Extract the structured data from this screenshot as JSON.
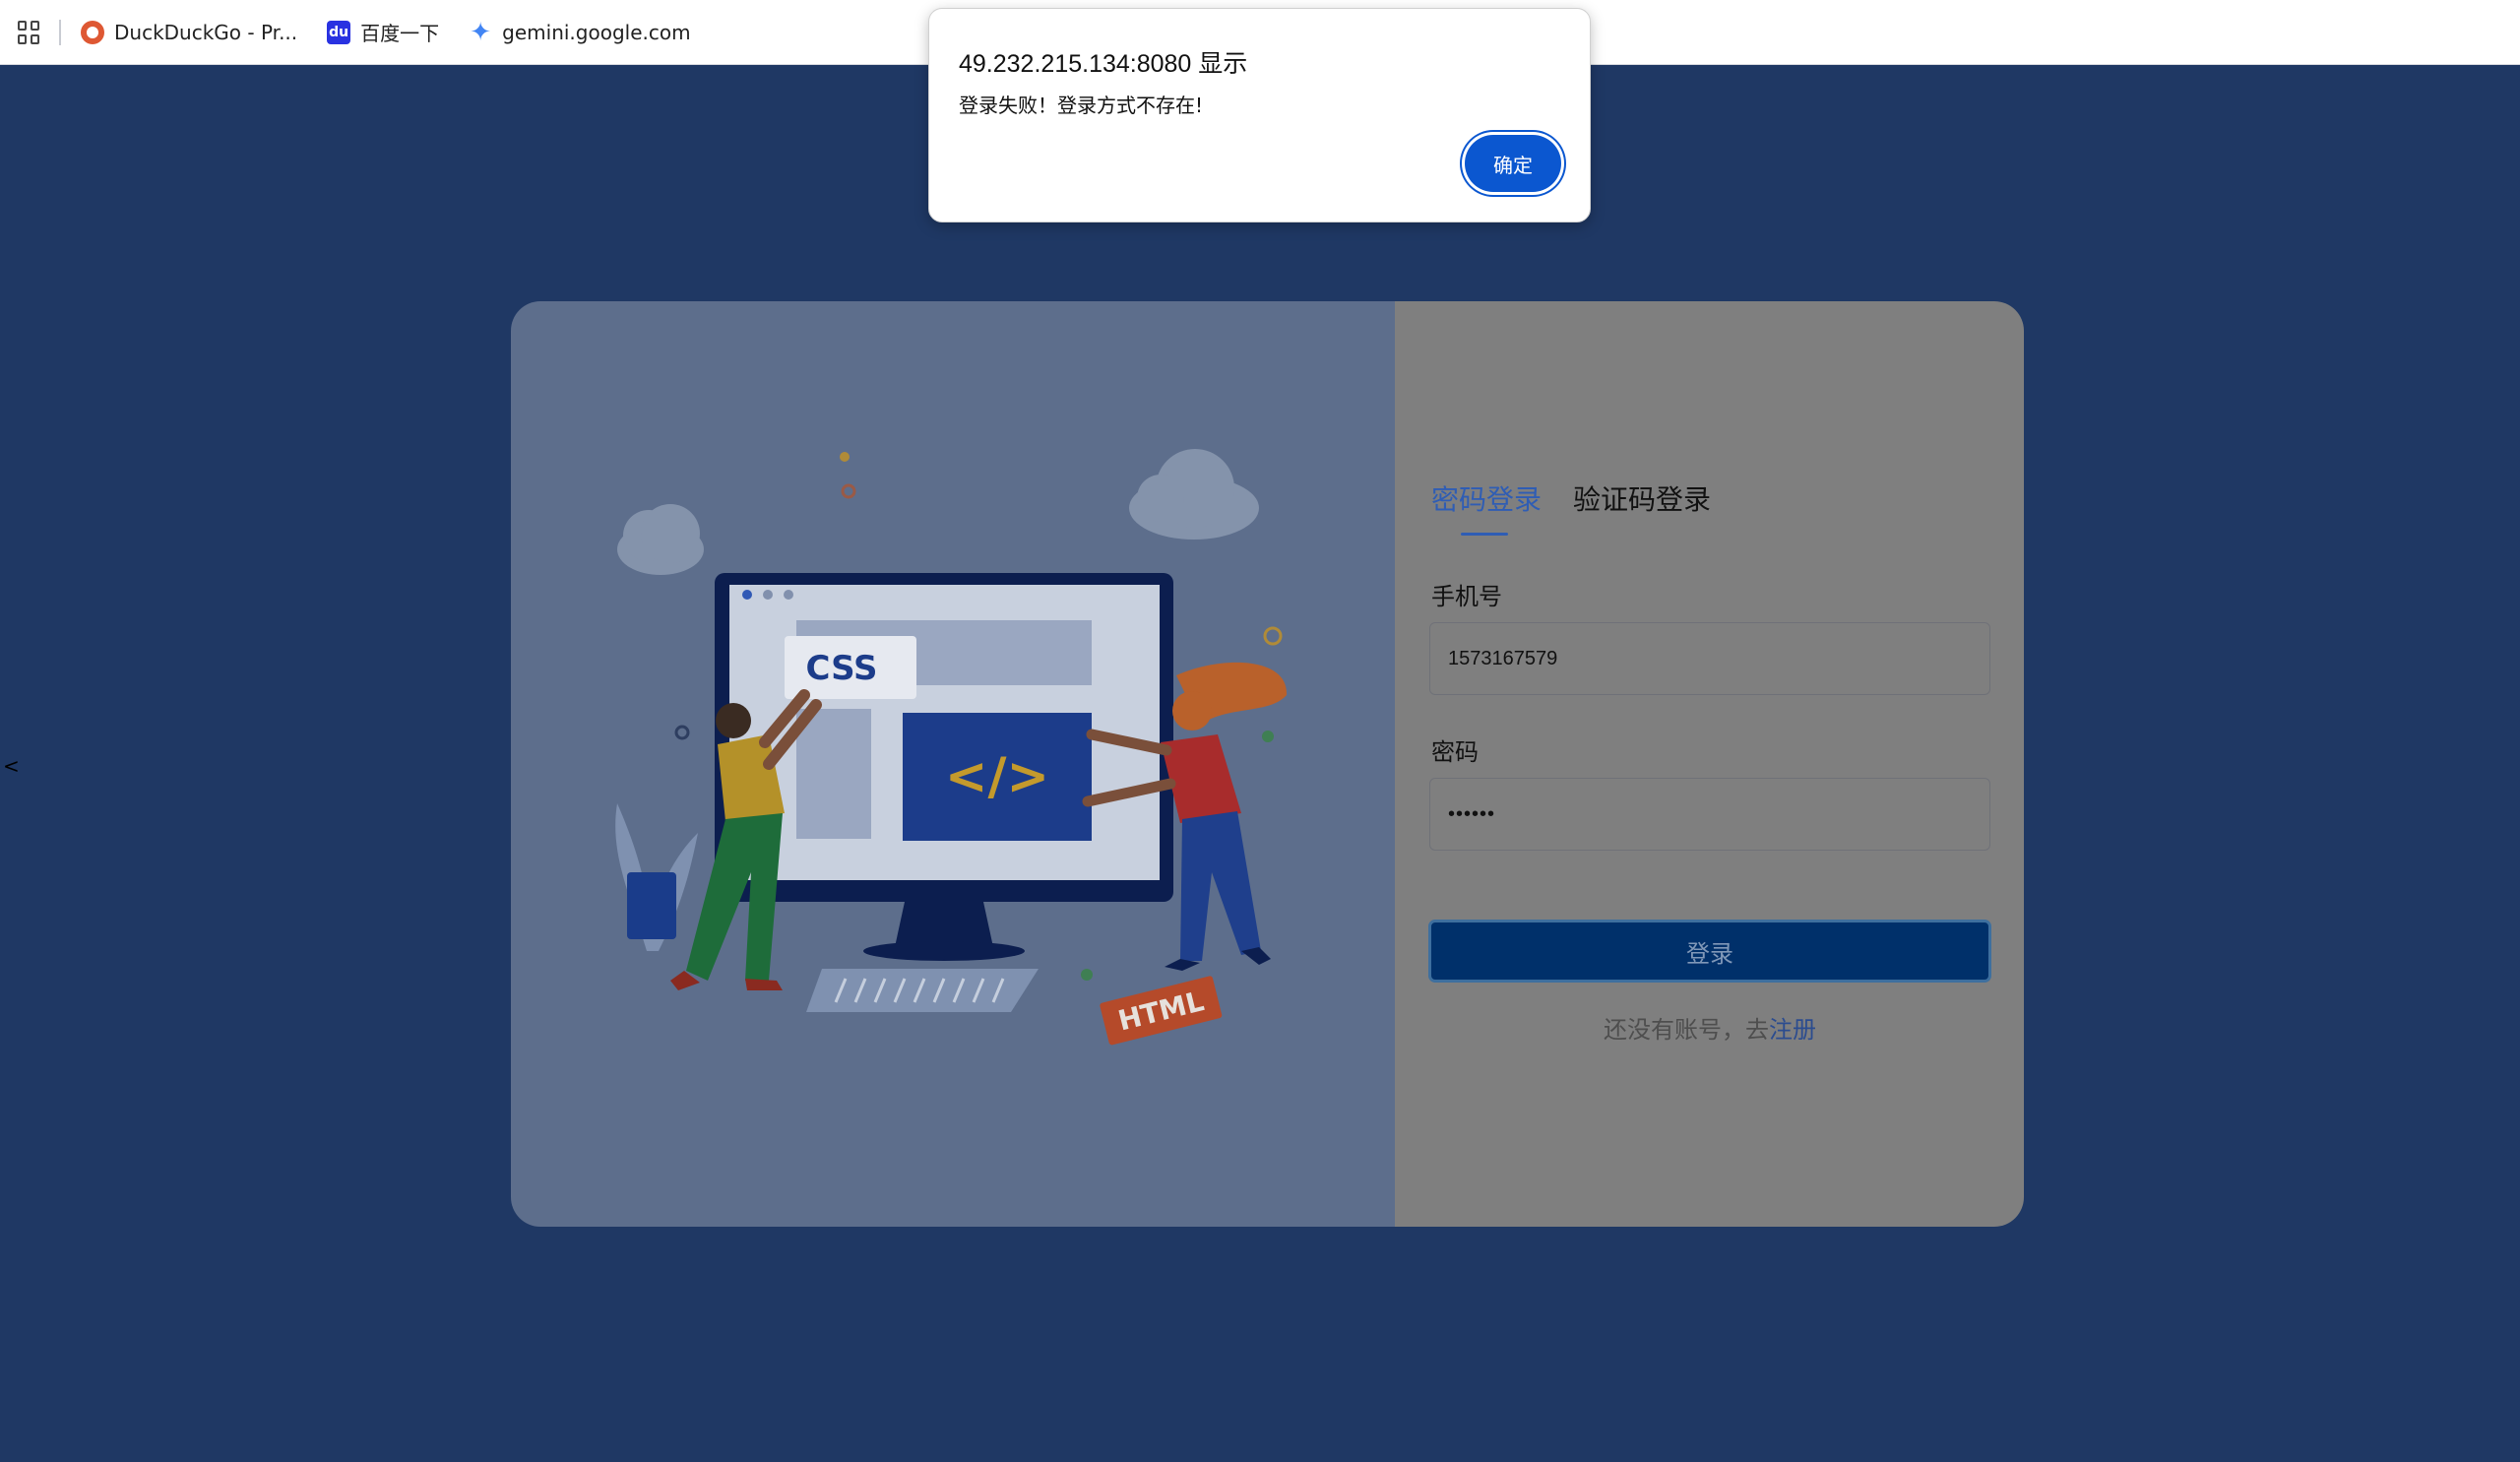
{
  "bookmarks": [
    {
      "label": "DuckDuckGo - Pr...",
      "icon": "duckduckgo-icon"
    },
    {
      "label": "百度一下",
      "icon": "baidu-icon"
    },
    {
      "label": "gemini.google.com",
      "icon": "gemini-icon"
    }
  ],
  "alert": {
    "title": "49.232.215.134:8080 显示",
    "message": "登录失败！登录方式不存在!",
    "ok_label": "确定"
  },
  "illustration": {
    "css_label": "CSS",
    "code_label": "</>",
    "html_label": "HTML"
  },
  "login": {
    "tabs": [
      "密码登录",
      "验证码登录"
    ],
    "active_tab": 0,
    "phone_label": "手机号",
    "phone_value": "1573167579",
    "password_label": "密码",
    "password_value": "••••••",
    "submit_label": "登录",
    "register_prompt": "还没有账号，去",
    "register_link": "注册"
  },
  "colors": {
    "page_background": "#1f3864",
    "accent": "#2f5db4",
    "dialog_button": "#0b57d0",
    "submit_button": "#00306a"
  }
}
